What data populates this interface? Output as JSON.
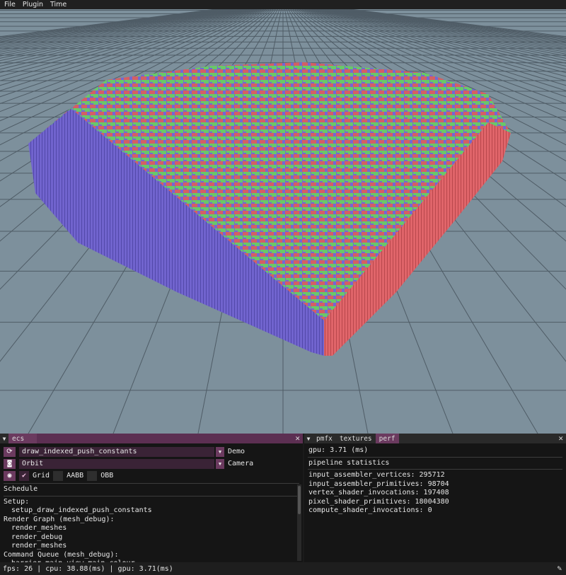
{
  "menu": [
    "File",
    "Plugin",
    "Time"
  ],
  "scene": {
    "colors": {
      "background": "#7d909c",
      "grid_line": "#4f5c66",
      "top_green": "#6fd36f",
      "side_blue": "#7b6de0",
      "side_red": "#e0656a"
    }
  },
  "ecs_panel": {
    "tab": "ecs",
    "close_label": "✕",
    "demo_value": "draw_indexed_push_constants",
    "demo_label": "Demo",
    "camera_value": "Orbit",
    "camera_label": "Camera",
    "grid_label": "Grid",
    "aabb_label": "AABB",
    "obb_label": "OBB",
    "schedule_label": "Schedule",
    "schedule": [
      {
        "text": "Setup:",
        "indent": 0
      },
      {
        "text": "setup_draw_indexed_push_constants",
        "indent": 1
      },
      {
        "text": "Render Graph (mesh_debug):",
        "indent": 0
      },
      {
        "text": "render_meshes",
        "indent": 1
      },
      {
        "text": "render_debug",
        "indent": 1
      },
      {
        "text": "render_meshes",
        "indent": 1
      },
      {
        "text": "Command Queue (mesh_debug):",
        "indent": 0
      },
      {
        "text": "barrier main view-main colour",
        "indent": 1
      }
    ]
  },
  "perf_panel": {
    "tabs": [
      "pmfx",
      "textures",
      "perf"
    ],
    "close_label": "✕",
    "gpu": "gpu: 3.71 (ms)",
    "header": "pipeline statistics",
    "stats": [
      "input_assembler_vertices: 295712",
      "input_assembler_primitives: 98704",
      "vertex_shader_invocations: 197408",
      "pixel_shader_primitives: 18004380",
      "compute_shader_invocations: 0"
    ]
  },
  "status": "fps: 26 | cpu: 38.88(ms) | gpu: 3.71(ms)"
}
